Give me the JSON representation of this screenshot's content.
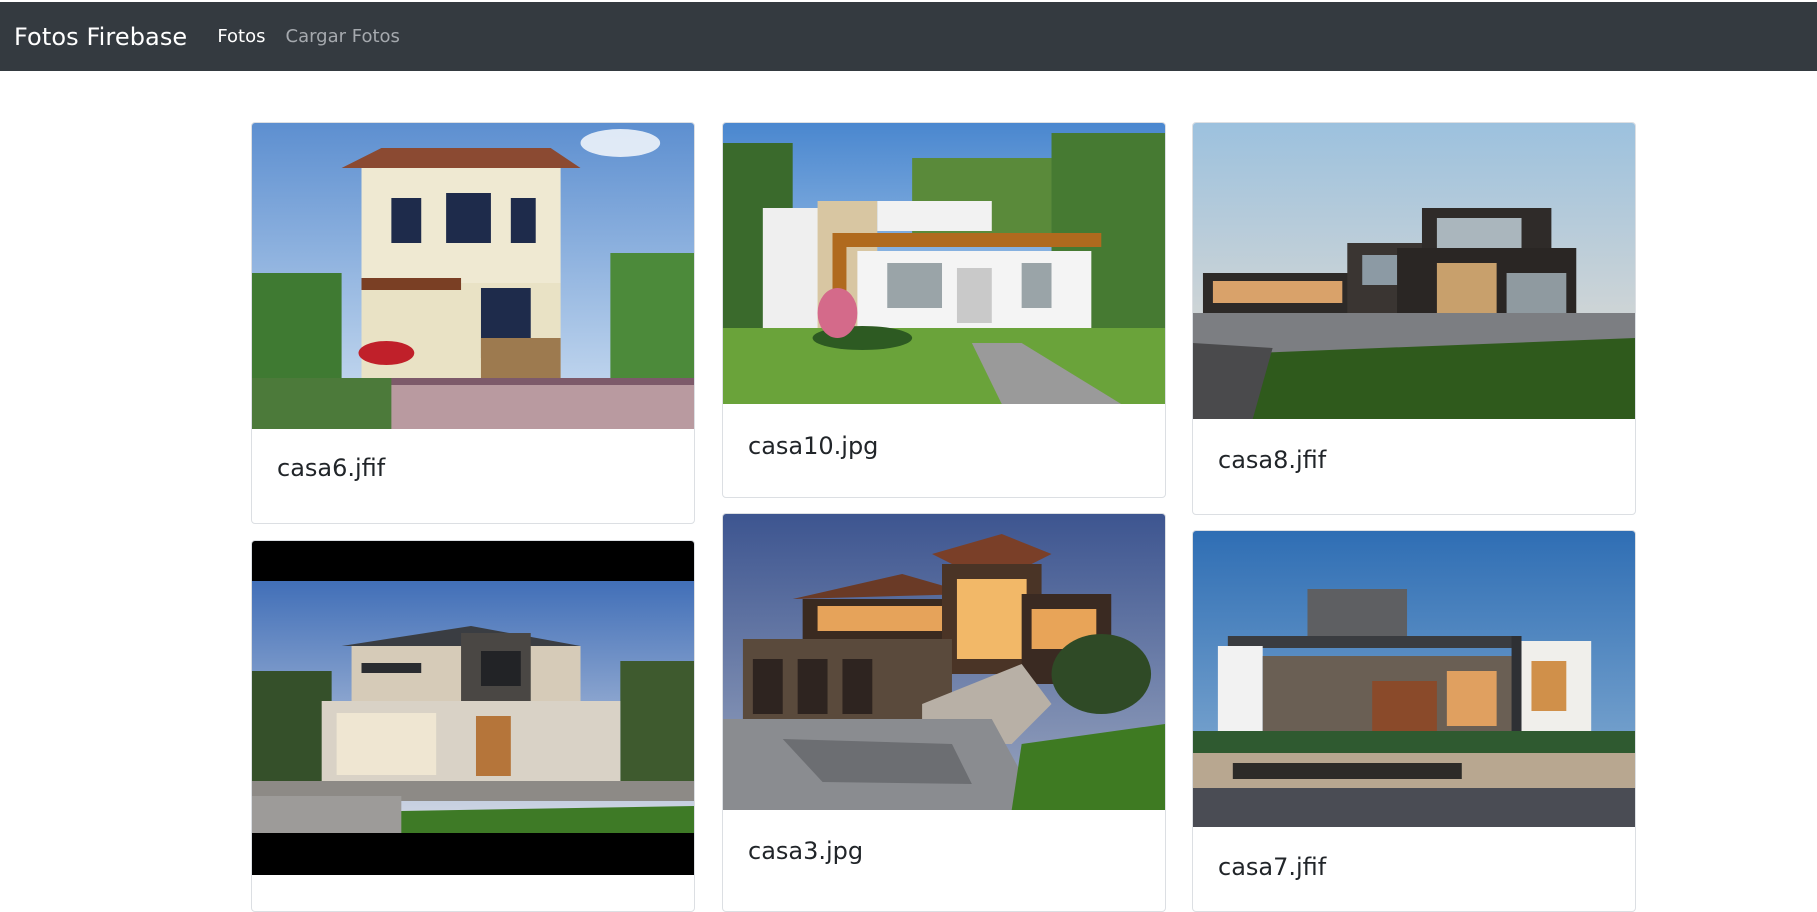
{
  "navbar": {
    "brand": "Fotos Firebase",
    "links": [
      {
        "label": "Fotos",
        "active": true
      },
      {
        "label": "Cargar Fotos",
        "active": false
      }
    ]
  },
  "colors": {
    "navbar_bg": "#343a40",
    "card_border": "#dcdfe3",
    "text": "#212529"
  },
  "cards": [
    {
      "title": "casa6.jfif",
      "image": "two-story-villa-with-balcony-photo"
    },
    {
      "title": "casa10.jpg",
      "image": "modern-single-story-house-photo"
    },
    {
      "title": "casa8.jfif",
      "image": "dark-modern-box-house-photo"
    },
    {
      "title": "",
      "image": "two-story-suburban-house-photo"
    },
    {
      "title": "casa3.jpg",
      "image": "hillside-house-at-dusk-photo"
    },
    {
      "title": "casa7.jfif",
      "image": "modern-house-with-carport-photo"
    }
  ]
}
